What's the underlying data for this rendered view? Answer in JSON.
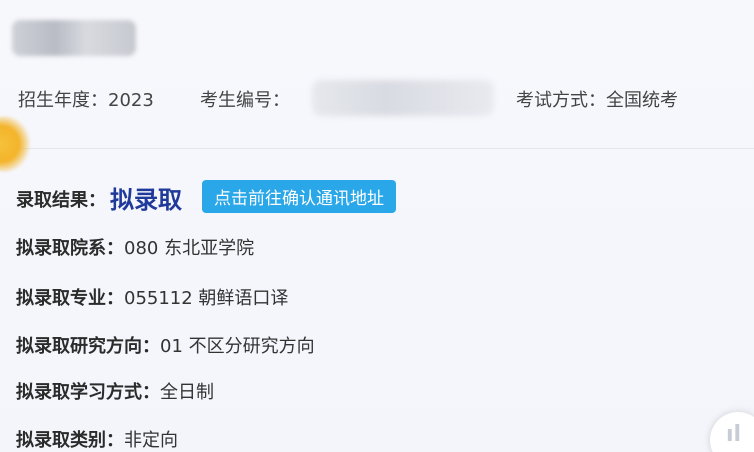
{
  "header": {
    "enroll_year_label": "招生年度：",
    "enroll_year_value": "2023",
    "exam_number_label": "考生编号：",
    "exam_mode_label": "考试方式：",
    "exam_mode_value": "全国统考"
  },
  "result": {
    "label": "录取结果：",
    "value": "拟录取",
    "confirm_button": "点击前往确认通讯地址"
  },
  "details": [
    {
      "label": "拟录取院系：",
      "value": "080 东北亚学院"
    },
    {
      "label": "拟录取专业：",
      "value": "055112 朝鲜语口译"
    },
    {
      "label": "拟录取研究方向：",
      "value": "01 不区分研究方向"
    },
    {
      "label": "拟录取学习方式：",
      "value": "全日制"
    },
    {
      "label": "拟录取类别：",
      "value": "非定向"
    }
  ],
  "corner_button": {
    "icon": "cut-off-icon"
  },
  "colors": {
    "accent_button": "#2aa7e8",
    "result_text": "#1f3a9a"
  }
}
